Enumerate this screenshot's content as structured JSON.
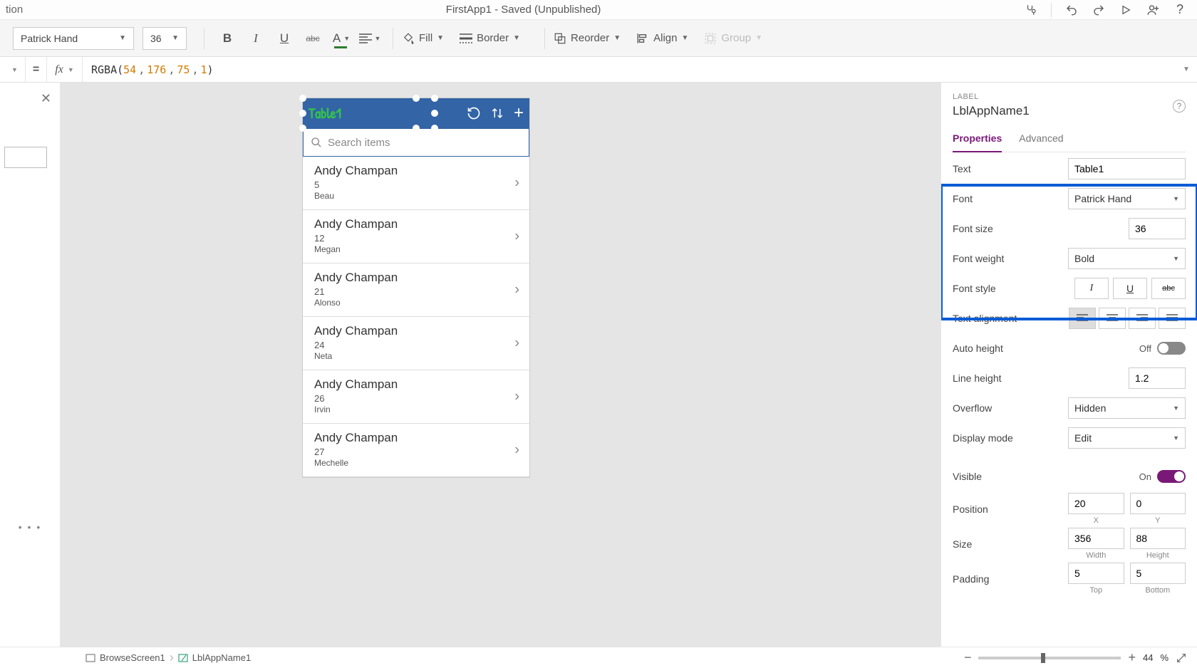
{
  "title": {
    "left_fragment": "tion",
    "center": "FirstApp1 - Saved (Unpublished)"
  },
  "toolbar": {
    "font": "Patrick Hand",
    "font_size": "36",
    "fill": "Fill",
    "border": "Border",
    "reorder": "Reorder",
    "align": "Align",
    "group": "Group"
  },
  "formula": {
    "eq": "=",
    "fx": "fx",
    "fn": "RGBA",
    "args": [
      "54",
      "176",
      "75",
      "1"
    ]
  },
  "phone": {
    "title": "Table1",
    "search_placeholder": "Search items",
    "items": [
      {
        "title": "Andy Champan",
        "sub1": "5",
        "sub2": "Beau"
      },
      {
        "title": "Andy Champan",
        "sub1": "12",
        "sub2": "Megan"
      },
      {
        "title": "Andy Champan",
        "sub1": "21",
        "sub2": "Alonso"
      },
      {
        "title": "Andy Champan",
        "sub1": "24",
        "sub2": "Neta"
      },
      {
        "title": "Andy Champan",
        "sub1": "26",
        "sub2": "Irvin"
      },
      {
        "title": "Andy Champan",
        "sub1": "27",
        "sub2": "Mechelle"
      }
    ]
  },
  "panel": {
    "type": "LABEL",
    "name": "LblAppName1",
    "tab_props": "Properties",
    "tab_adv": "Advanced",
    "labels": {
      "text": "Text",
      "font": "Font",
      "font_size": "Font size",
      "font_weight": "Font weight",
      "font_style": "Font style",
      "text_align": "Text alignment",
      "auto_height": "Auto height",
      "line_height": "Line height",
      "overflow": "Overflow",
      "display_mode": "Display mode",
      "visible": "Visible",
      "position": "Position",
      "size": "Size",
      "padding": "Padding"
    },
    "values": {
      "text": "Table1",
      "font": "Patrick Hand",
      "font_size": "36",
      "font_weight": "Bold",
      "auto_height": "Off",
      "line_height": "1.2",
      "overflow": "Hidden",
      "display_mode": "Edit",
      "visible": "On",
      "pos_x": "20",
      "pos_y": "0",
      "size_w": "356",
      "size_h": "88",
      "pad_top": "5",
      "pad_bottom": "5"
    },
    "sublabels": {
      "x": "X",
      "y": "Y",
      "w": "Width",
      "h": "Height",
      "top": "Top",
      "bottom": "Bottom"
    }
  },
  "status": {
    "bc1": "BrowseScreen1",
    "bc2": "LblAppName1",
    "zoom_pct": "44",
    "zoom_unit": "%"
  }
}
